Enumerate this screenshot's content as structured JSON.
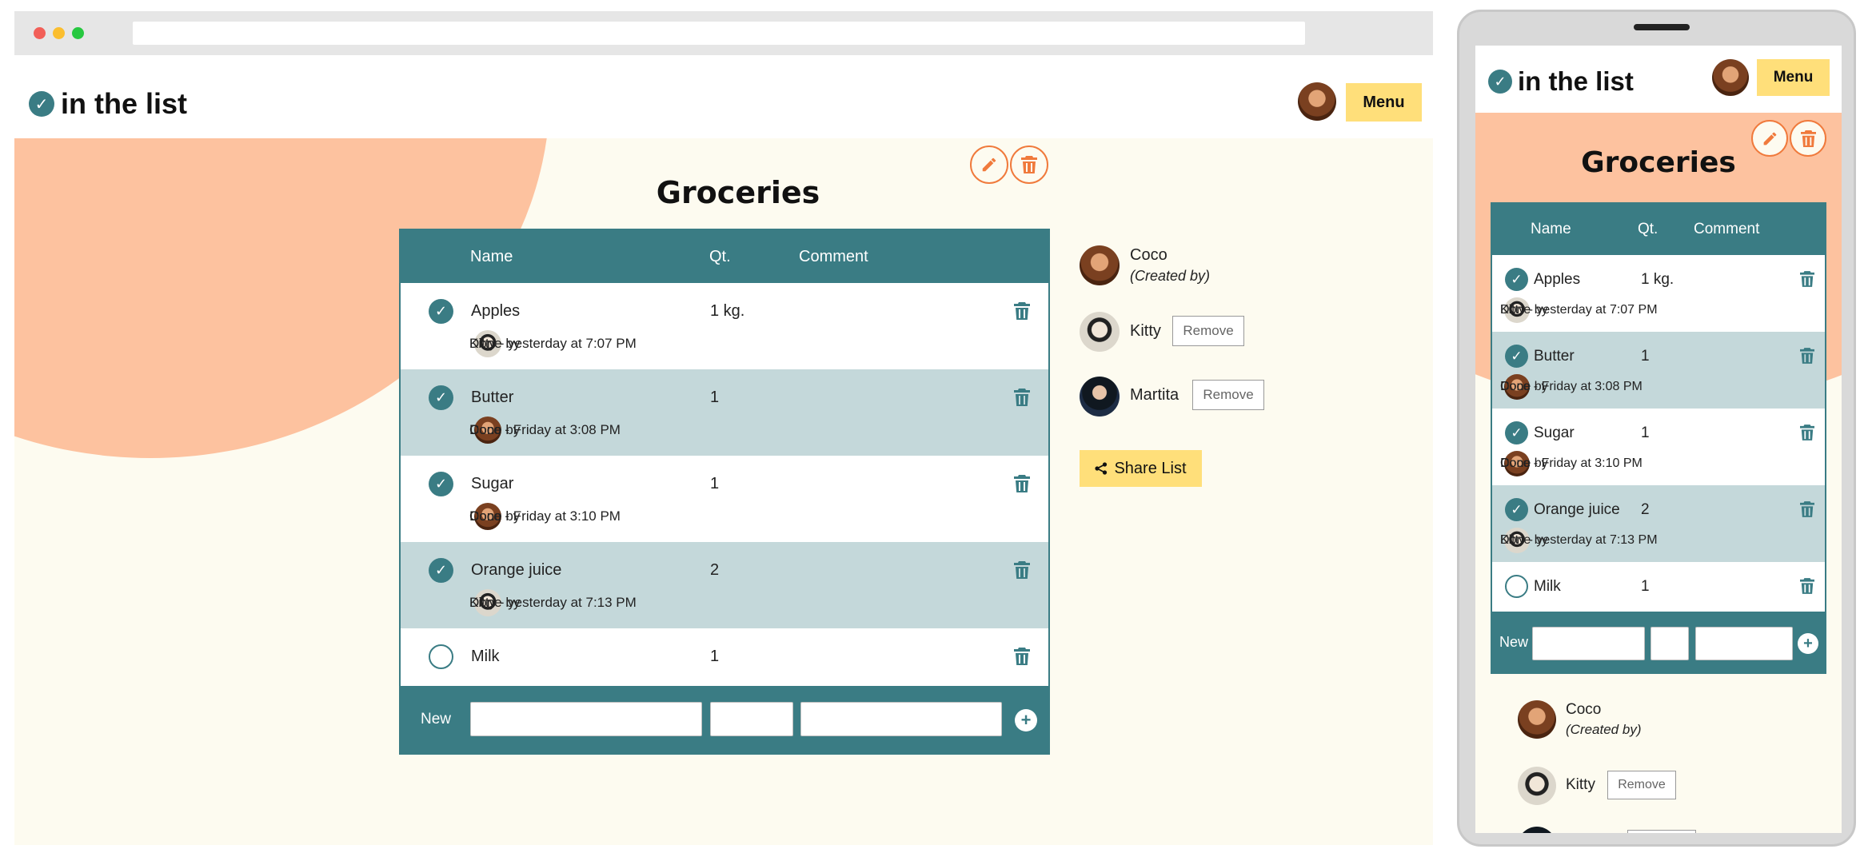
{
  "app": {
    "logo_text": "in the list",
    "menu_label": "Menu"
  },
  "list": {
    "title": "Groceries",
    "columns": {
      "name": "Name",
      "qty": "Qt.",
      "comment": "Comment"
    },
    "items": [
      {
        "name": "Apples",
        "qty": "1 kg.",
        "done": true,
        "done_by_prefix": "Done by",
        "done_by": "Kitty - yesterday at 7:07 PM"
      },
      {
        "name": "Butter",
        "qty": "1",
        "done": true,
        "done_by_prefix": "Done by",
        "done_by": "Coco - Friday at 3:08 PM"
      },
      {
        "name": "Sugar",
        "qty": "1",
        "done": true,
        "done_by_prefix": "Done by",
        "done_by": "Coco - Friday at 3:10 PM"
      },
      {
        "name": "Orange juice",
        "qty": "2",
        "done": true,
        "done_by_prefix": "Done by",
        "done_by": "Kitty - yesterday at 7:13 PM"
      },
      {
        "name": "Milk",
        "qty": "1",
        "done": false
      }
    ],
    "new_label": "New"
  },
  "members": [
    {
      "name": "Coco",
      "role": "(Created by)"
    },
    {
      "name": "Kitty",
      "action": "Remove"
    },
    {
      "name": "Martita",
      "action": "Remove"
    }
  ],
  "share_label": "Share List",
  "icons": [
    "check-icon",
    "pencil-icon",
    "trash-icon",
    "plus-icon",
    "share-icon"
  ],
  "colors": {
    "teal": "#3a7c84",
    "peach": "#fdc29f",
    "cream": "#fdfbf0",
    "yellow": "#ffdf7a",
    "orange": "#f07a3c"
  }
}
